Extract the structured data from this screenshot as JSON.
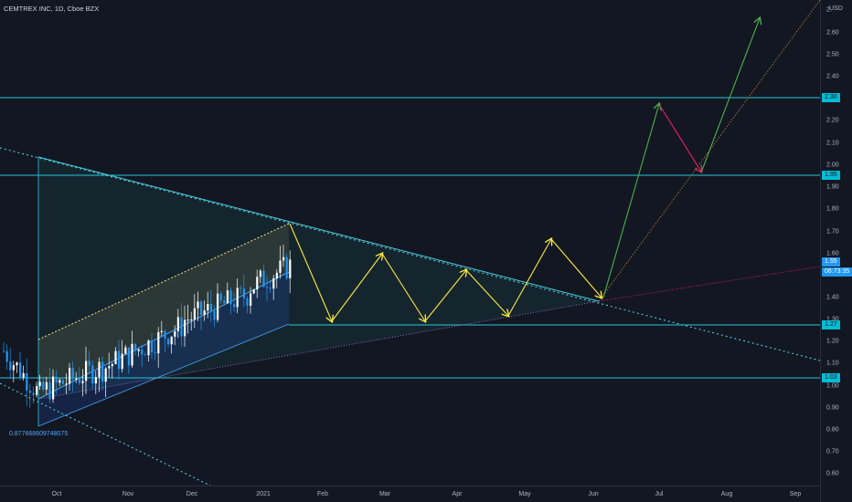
{
  "symbol_title": "CEMTREX INC, 1D, Cboe BZX",
  "low_note": "0.877668609748075",
  "currency": "USD",
  "price_ticks": [
    "2.60",
    "2.50",
    "2.40",
    "2.20",
    "2.10",
    "2.00",
    "1.90",
    "1.80",
    "1.70",
    "1.60",
    "1.40",
    "1.30",
    "1.20",
    "1.10",
    "1.00",
    "0.90",
    "0.80",
    "0.70",
    "0.60"
  ],
  "top_tick": "2.",
  "price_labels": [
    {
      "text": "2.30",
      "style": "cyan"
    },
    {
      "text": "1.95",
      "style": "cyan"
    },
    {
      "text": "1.55",
      "style": "blue"
    },
    {
      "text": "06:73:35",
      "style": "blue"
    },
    {
      "text": "1.27",
      "style": "cyan"
    },
    {
      "text": "1.03",
      "style": "cyan"
    }
  ],
  "time_labels": [
    "Oct",
    "Nov",
    "Dec",
    "2021",
    "Feb",
    "Mar",
    "Apr",
    "May",
    "Jun",
    "Jul",
    "Aug",
    "Sep"
  ],
  "colors": {
    "background": "#131722",
    "up_candle": "#ffffff",
    "down_candle": "#2196f3",
    "horizontal_levels": "#26c6da",
    "zigzag": "#ffeb3b",
    "rise_arrow": "#4caf50",
    "pullback_arrow": "#e91e63",
    "upper_channel": "#ffe082",
    "lower_channel": "#42a5f5"
  }
}
